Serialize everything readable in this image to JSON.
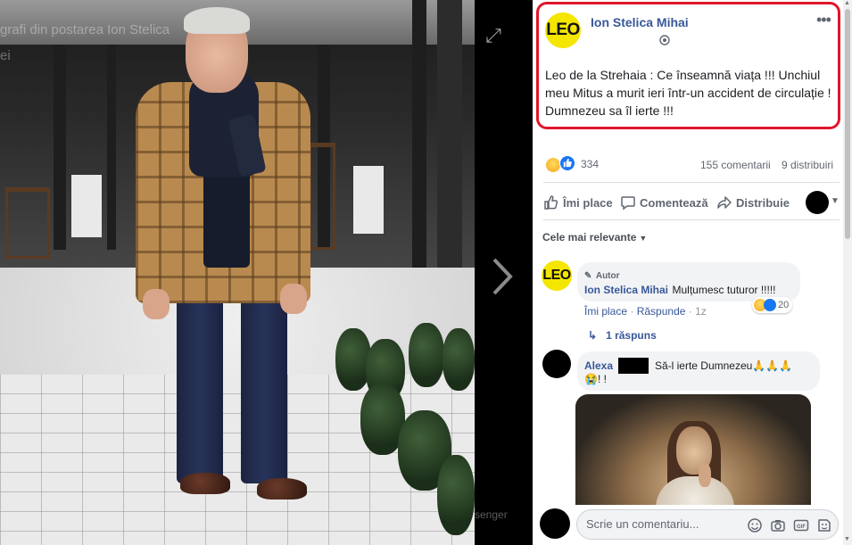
{
  "viewer": {
    "overlay_caption": "grafi din postarea Ion Stelica",
    "overlay_partial": "ei",
    "expand_icon": "expand-icon",
    "next_icon": "chevron-right-icon",
    "messenger_label": "senger"
  },
  "post": {
    "author": "Ion Stelica Mihai",
    "avatar_text": "LEO",
    "date": "",
    "privacy_icon": "globe-icon",
    "more_icon": "more-options-icon",
    "text": "Leo de la Strehaia : Ce înseamnă viața !!! Unchiul meu Mitus a murit ieri într-un accident de circulație ! Dumnezeu sa îl ierte !!!",
    "highlight_color": "#e0162b"
  },
  "stats": {
    "reaction_count": "334",
    "comments": "155 comentarii",
    "shares": "9 distribuiri"
  },
  "actions": {
    "like": "Îmi place",
    "comment": "Comentează",
    "share": "Distribuie"
  },
  "sort": {
    "label": "Cele mai relevante"
  },
  "comments": [
    {
      "badge": "Autor",
      "author": "Ion Stelica Mihai",
      "avatar_text": "LEO",
      "text": "Mulțumesc tuturor !!!!!",
      "like_label": "Îmi place",
      "reply_label": "Răspunde",
      "time": "1z",
      "reaction_count": "20",
      "replies_label": "1 răspuns"
    },
    {
      "author": "Alexa",
      "text": "Să-l ierte Dumnezeu🙏🙏🙏",
      "text_line2": "😭! !"
    }
  ],
  "composer": {
    "placeholder": "Scrie un comentariu..."
  },
  "colors": {
    "link_blue": "#385898",
    "facebook_blue": "#1877f2",
    "leo_yellow": "#f5e600"
  }
}
